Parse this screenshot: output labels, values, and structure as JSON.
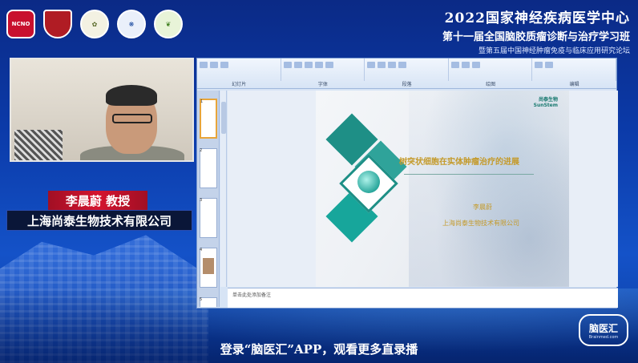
{
  "header": {
    "title": "2022国家神经疾病医学中心",
    "subtitle": "第十一届全国脑胶质瘤诊断与治疗学习班",
    "subtitle2": "暨第五届中国神经肿瘤免疫与临床应用研究论坛",
    "logos": [
      {
        "name": "ncno-logo",
        "label": "NCNO"
      },
      {
        "name": "university-shield-logo",
        "label": ""
      },
      {
        "name": "seal-logo-1",
        "label": ""
      },
      {
        "name": "seal-logo-2",
        "label": ""
      },
      {
        "name": "seal-logo-3",
        "label": ""
      }
    ]
  },
  "speaker": {
    "name": "李晨蔚 教授",
    "company": "上海尚泰生物技术有限公司"
  },
  "ppt": {
    "ribbon_labels": [
      "幻灯片",
      "字体",
      "段落",
      "绘图",
      "编辑"
    ],
    "slide_numbers": [
      "1",
      "2",
      "3",
      "4",
      "5"
    ],
    "notes_placeholder": "单击此处添加备注"
  },
  "slide": {
    "brand_cn": "尚泰生物",
    "brand_en": "SunStem",
    "title": "树突状细胞在实体肿瘤治疗的进展",
    "author": "李晨蔚",
    "company": "上海尚泰生物技术有限公司"
  },
  "footer": {
    "caption": "登录“脑医汇”APP，观看更多直录播",
    "logo_cn": "脑医汇",
    "logo_en": "Brainmed.com"
  },
  "colors": {
    "background": "#0b3aa8",
    "banner_red": "#d4142f",
    "slide_gold": "#c49a2a",
    "slide_teal": "#1e8f86"
  }
}
